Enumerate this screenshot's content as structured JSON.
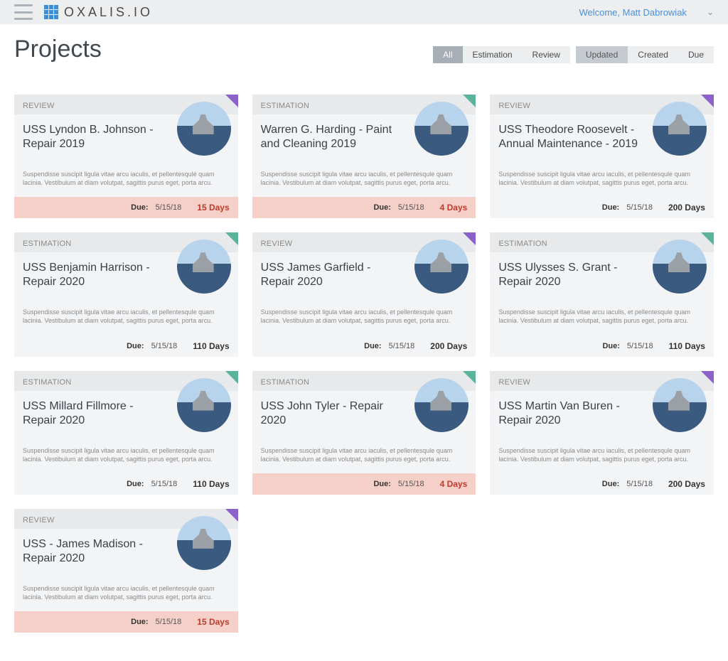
{
  "header": {
    "logo_text": "OXALIS.IO",
    "welcome": "Welcome, Matt Dabrowiak"
  },
  "page": {
    "title": "Projects"
  },
  "filter_tabs": {
    "items": [
      "All",
      "Estimation",
      "Review"
    ],
    "active": "All"
  },
  "sort_tabs": {
    "items": [
      "Updated",
      "Created",
      "Due"
    ],
    "active": "Updated"
  },
  "desc_placeholder": "Suspendisse suscipit ligula vitae arcu iaculis, et pellentesqule quam lacinia. Vestibulum at diam volutpat, sagittis purus eget, porta arcu.",
  "due_label": "Due:",
  "cards": [
    {
      "status": "REVIEW",
      "corner": "purple",
      "title": "USS Lyndon B. Johnson - Repair 2019",
      "due": "5/15/18",
      "days": "15 Days",
      "warn": true
    },
    {
      "status": "ESTIMATION",
      "corner": "teal",
      "title": "Warren G. Harding - Paint and Cleaning 2019",
      "due": "5/15/18",
      "days": "4 Days",
      "warn": true
    },
    {
      "status": "REVIEW",
      "corner": "purple",
      "title": "USS Theodore Roosevelt - Annual Maintenance - 2019",
      "due": "5/15/18",
      "days": "200 Days",
      "warn": false
    },
    {
      "status": "ESTIMATION",
      "corner": "teal",
      "title": "USS Benjamin Harrison - Repair 2020",
      "due": "5/15/18",
      "days": "110 Days",
      "warn": false
    },
    {
      "status": "REVIEW",
      "corner": "purple",
      "title": "USS James Garfield - Repair 2020",
      "due": "5/15/18",
      "days": "200 Days",
      "warn": false
    },
    {
      "status": "ESTIMATION",
      "corner": "teal",
      "title": "USS Ulysses S. Grant - Repair 2020",
      "due": "5/15/18",
      "days": "110 Days",
      "warn": false
    },
    {
      "status": "ESTIMATION",
      "corner": "teal",
      "title": "USS Millard Fillmore - Repair 2020",
      "due": "5/15/18",
      "days": "110 Days",
      "warn": false
    },
    {
      "status": "ESTIMATION",
      "corner": "teal",
      "title": "USS John Tyler - Repair 2020",
      "due": "5/15/18",
      "days": "4 Days",
      "warn": true
    },
    {
      "status": "REVIEW",
      "corner": "purple",
      "title": "USS Martin Van Buren - Repair 2020",
      "due": "5/15/18",
      "days": "200 Days",
      "warn": false
    },
    {
      "status": "REVIEW",
      "corner": "purple",
      "title": "USS - James Madison - Repair 2020",
      "due": "5/15/18",
      "days": "15 Days",
      "warn": true
    }
  ]
}
